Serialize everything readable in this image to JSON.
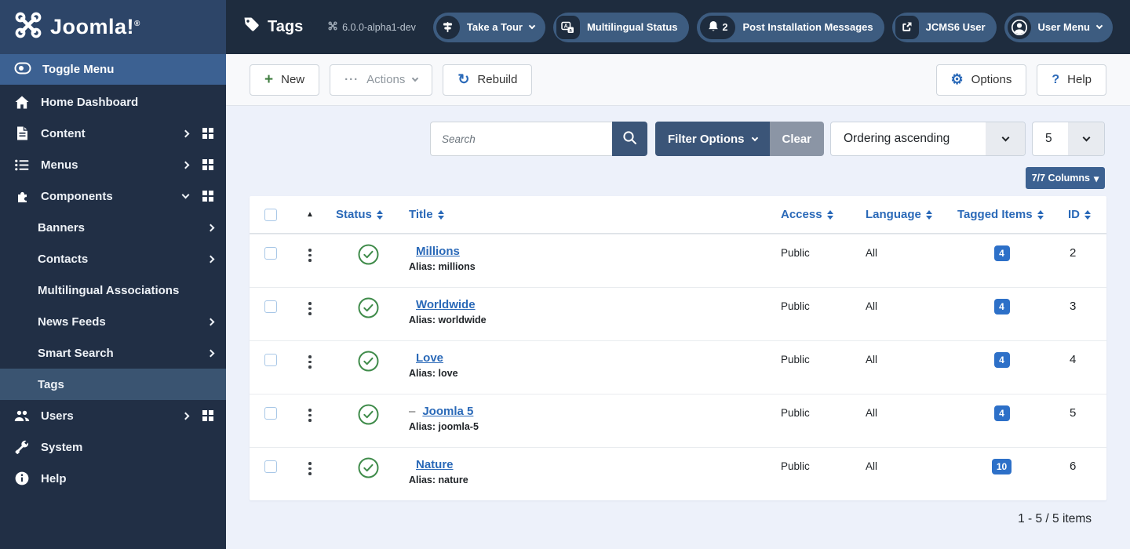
{
  "colors": {
    "topbar_bg": "#1e2c3e",
    "sidebar_bg": "#212f45",
    "logo_bg": "#2d4568",
    "toggle_row_bg": "#3c6192",
    "active_item_bg": "#3a5471",
    "pill_bg": "#3d5c80",
    "accent_blue": "#2a69b8",
    "button_dark_blue": "#3b5578",
    "badge_blue": "#2d70c8",
    "status_green": "#3f8b4a",
    "content_bg": "#edf1fa"
  },
  "sidebar": {
    "logo_text": "Joomla!",
    "toggle_label": "Toggle Menu",
    "items": [
      {
        "label": "Home Dashboard"
      },
      {
        "label": "Content"
      },
      {
        "label": "Menus"
      },
      {
        "label": "Components"
      },
      {
        "label": "Banners"
      },
      {
        "label": "Contacts"
      },
      {
        "label": "Multilingual Associations"
      },
      {
        "label": "News Feeds"
      },
      {
        "label": "Smart Search"
      },
      {
        "label": "Tags"
      },
      {
        "label": "Users"
      },
      {
        "label": "System"
      },
      {
        "label": "Help"
      }
    ]
  },
  "topbar": {
    "title": "Tags",
    "version": "6.0.0-alpha1-dev",
    "pills": [
      {
        "label": "Take a Tour"
      },
      {
        "label": "Multilingual Status"
      },
      {
        "label": "Post Installation Messages",
        "badge": "2"
      },
      {
        "label": "JCMS6 User"
      },
      {
        "label": "User Menu"
      }
    ]
  },
  "toolbar": {
    "new_label": "New",
    "actions_label": "Actions",
    "rebuild_label": "Rebuild",
    "options_label": "Options",
    "help_label": "Help"
  },
  "filters": {
    "search_placeholder": "Search",
    "filter_options_label": "Filter Options",
    "clear_label": "Clear",
    "ordering_value": "Ordering ascending",
    "per_page_value": "5",
    "columns_label": "7/7 Columns"
  },
  "icons": {
    "new_plus": "+",
    "actions_ellipsis": "···",
    "rebuild_refresh": "↻",
    "options_gear": "⚙",
    "help_question": "?",
    "ordering_asc_triangle": "▲",
    "columns_caret": "▾"
  },
  "table": {
    "headers": {
      "status": "Status",
      "title": "Title",
      "access": "Access",
      "language": "Language",
      "tagged": "Tagged Items",
      "id": "ID"
    },
    "rows": [
      {
        "prefix": "",
        "title": "Millions",
        "alias": "Alias: millions",
        "access": "Public",
        "language": "All",
        "tagged": "4",
        "id": "2"
      },
      {
        "prefix": "",
        "title": "Worldwide",
        "alias": "Alias: worldwide",
        "access": "Public",
        "language": "All",
        "tagged": "4",
        "id": "3"
      },
      {
        "prefix": "",
        "title": "Love",
        "alias": "Alias: love",
        "access": "Public",
        "language": "All",
        "tagged": "4",
        "id": "4"
      },
      {
        "prefix": "–",
        "title": "Joomla 5",
        "alias": "Alias: joomla-5",
        "access": "Public",
        "language": "All",
        "tagged": "4",
        "id": "5"
      },
      {
        "prefix": "",
        "title": "Nature",
        "alias": "Alias: nature",
        "access": "Public",
        "language": "All",
        "tagged": "10",
        "id": "6"
      }
    ]
  },
  "footer": {
    "count": "1 - 5 / 5 items"
  }
}
